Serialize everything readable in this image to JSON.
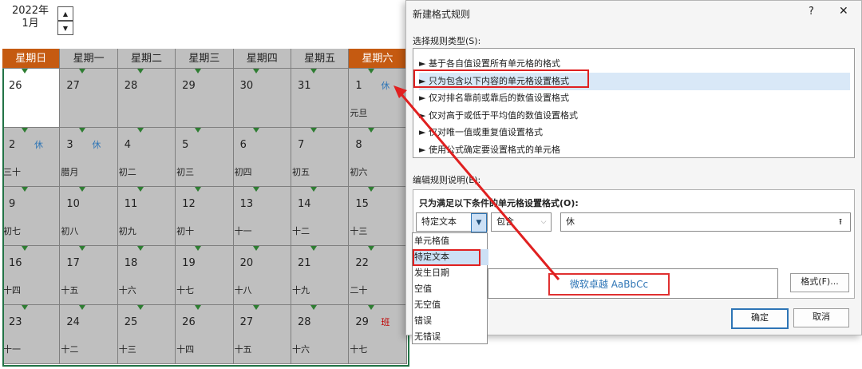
{
  "calendar": {
    "year_label": "2022年",
    "month_label": "1月",
    "spin_up_icon": "triangle-up",
    "spin_down_icon": "triangle-down",
    "weekdays": [
      "星期日",
      "星期一",
      "星期二",
      "星期三",
      "星期四",
      "星期五",
      "星期六"
    ],
    "weekend_color": "#c55a11",
    "cell_color": "#bfbfbf",
    "rows": [
      [
        {
          "day": "26",
          "lunar": "",
          "mark": ""
        },
        {
          "day": "27",
          "lunar": "",
          "mark": ""
        },
        {
          "day": "28",
          "lunar": "",
          "mark": ""
        },
        {
          "day": "29",
          "lunar": "",
          "mark": ""
        },
        {
          "day": "30",
          "lunar": "",
          "mark": ""
        },
        {
          "day": "31",
          "lunar": "",
          "mark": ""
        },
        {
          "day": "1",
          "lunar": "元旦",
          "mark": "休"
        }
      ],
      [
        {
          "day": "2",
          "lunar": "三十",
          "mark": "休"
        },
        {
          "day": "3",
          "lunar": "腊月",
          "mark": "休"
        },
        {
          "day": "4",
          "lunar": "初二",
          "mark": ""
        },
        {
          "day": "5",
          "lunar": "初三",
          "mark": ""
        },
        {
          "day": "6",
          "lunar": "初四",
          "mark": ""
        },
        {
          "day": "7",
          "lunar": "初五",
          "mark": ""
        },
        {
          "day": "8",
          "lunar": "初六",
          "mark": ""
        }
      ],
      [
        {
          "day": "9",
          "lunar": "初七",
          "mark": ""
        },
        {
          "day": "10",
          "lunar": "初八",
          "mark": ""
        },
        {
          "day": "11",
          "lunar": "初九",
          "mark": ""
        },
        {
          "day": "12",
          "lunar": "初十",
          "mark": ""
        },
        {
          "day": "13",
          "lunar": "十一",
          "mark": ""
        },
        {
          "day": "14",
          "lunar": "十二",
          "mark": ""
        },
        {
          "day": "15",
          "lunar": "十三",
          "mark": ""
        }
      ],
      [
        {
          "day": "16",
          "lunar": "十四",
          "mark": ""
        },
        {
          "day": "17",
          "lunar": "十五",
          "mark": ""
        },
        {
          "day": "18",
          "lunar": "十六",
          "mark": ""
        },
        {
          "day": "19",
          "lunar": "十七",
          "mark": ""
        },
        {
          "day": "20",
          "lunar": "十八",
          "mark": ""
        },
        {
          "day": "21",
          "lunar": "十九",
          "mark": ""
        },
        {
          "day": "22",
          "lunar": "二十",
          "mark": ""
        }
      ],
      [
        {
          "day": "23",
          "lunar": "十一",
          "mark": ""
        },
        {
          "day": "24",
          "lunar": "十二",
          "mark": ""
        },
        {
          "day": "25",
          "lunar": "十三",
          "mark": ""
        },
        {
          "day": "26",
          "lunar": "十四",
          "mark": ""
        },
        {
          "day": "27",
          "lunar": "十五",
          "mark": ""
        },
        {
          "day": "28",
          "lunar": "十六",
          "mark": ""
        },
        {
          "day": "29",
          "lunar": "十七",
          "mark": "班"
        }
      ]
    ]
  },
  "dialog": {
    "title": "新建格式规则",
    "help_label": "?",
    "close_label": "✕",
    "rule_type_label": "选择规则类型(S):",
    "rule_types": [
      "► 基于各自值设置所有单元格的格式",
      "► 只为包含以下内容的单元格设置格式",
      "► 仅对排名靠前或靠后的数值设置格式",
      "► 仅对高于或低于平均值的数值设置格式",
      "► 仅对唯一值或重复值设置格式",
      "► 使用公式确定要设置格式的单元格"
    ],
    "selected_rule_index": 1,
    "edit_label": "编辑规则说明(E):",
    "condition_heading": "只为满足以下条件的单元格设置格式(O):",
    "type_combo_value": "特定文本",
    "operator_combo_value": "包含",
    "text_value": "休",
    "collapse_icon": "collapse-arrow-up",
    "dropdown_options": [
      "单元格值",
      "特定文本",
      "发生日期",
      "空值",
      "无空值",
      "错误",
      "无错误"
    ],
    "selected_option_index": 1,
    "preview_text": "微软卓越  AaBbCc",
    "format_button": "格式(F)...",
    "ok_button": "确定",
    "cancel_button": "取消",
    "preview_color": "#2e75b6",
    "highlight_color": "#e02020"
  }
}
